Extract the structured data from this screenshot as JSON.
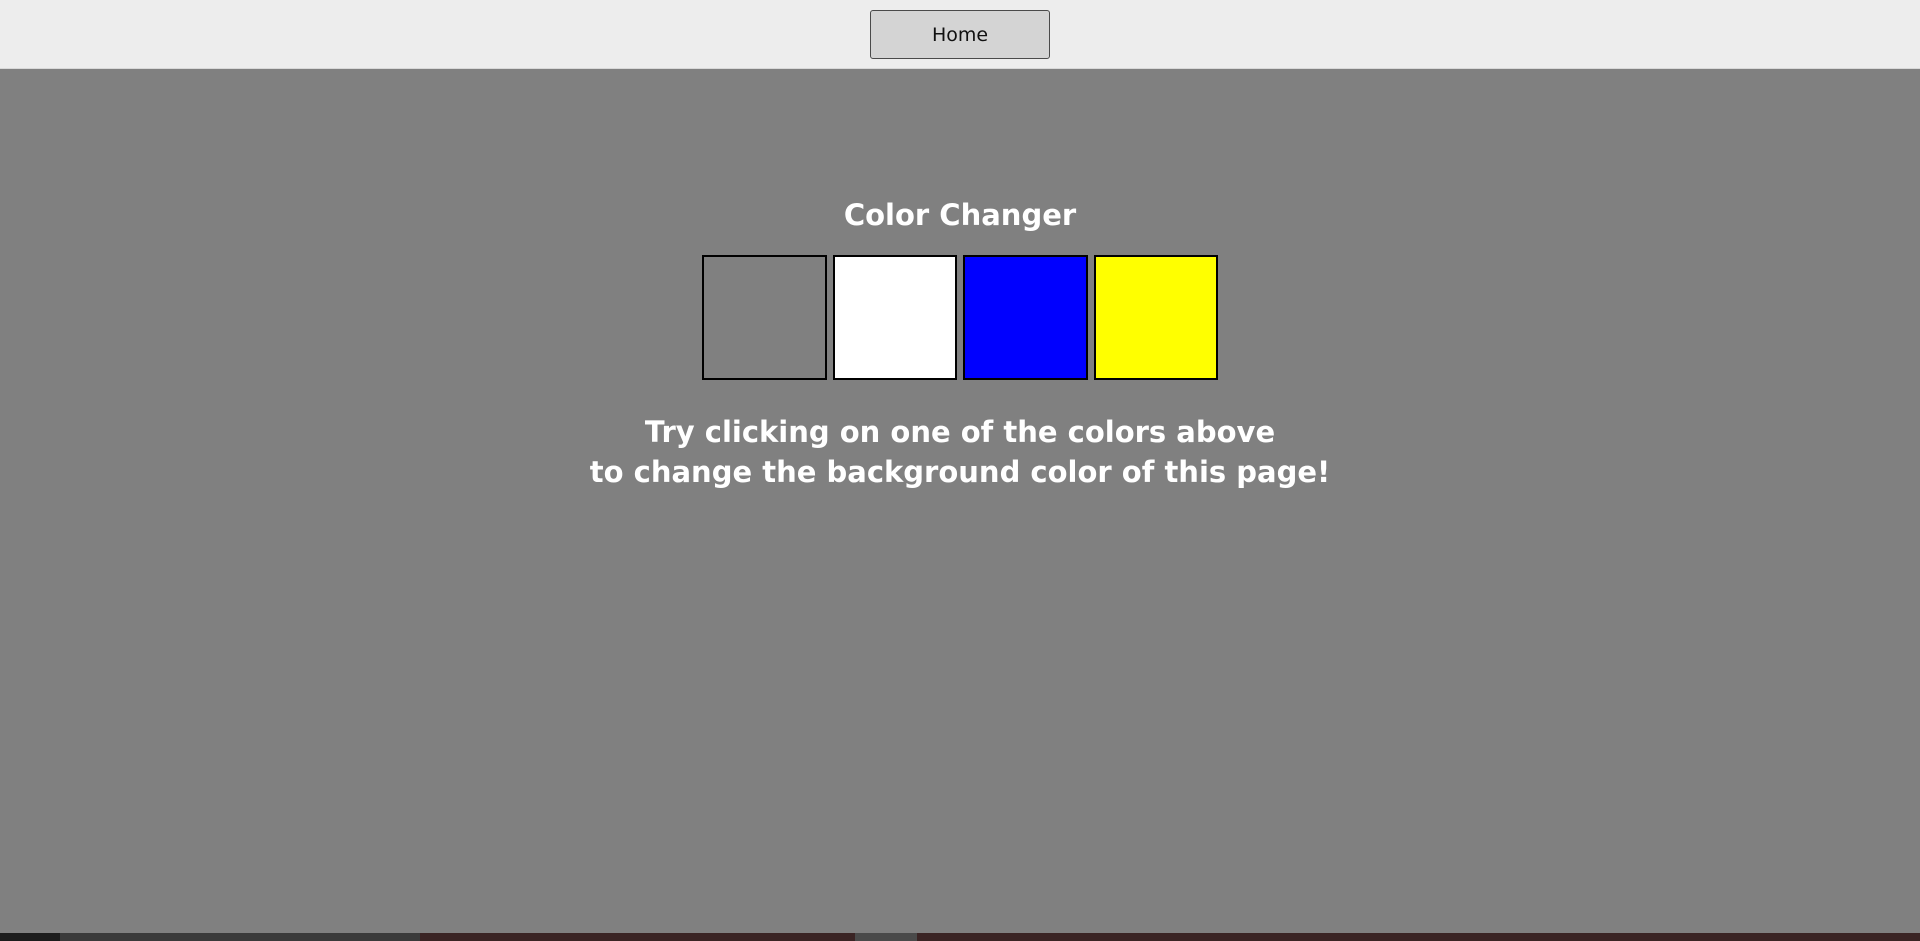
{
  "nav": {
    "home_label": "Home"
  },
  "content": {
    "title": "Color Changer",
    "instructions_line1": "Try clicking on one of the colors above",
    "instructions_line2": "to change the background color of this page!"
  },
  "swatches": [
    {
      "name": "gray",
      "color": "#808080"
    },
    {
      "name": "white",
      "color": "#ffffff"
    },
    {
      "name": "blue",
      "color": "#0000ff"
    },
    {
      "name": "yellow",
      "color": "#ffff00"
    }
  ],
  "colors": {
    "page_background": "#808080",
    "topbar_background": "#ededed",
    "text": "#ffffff"
  }
}
